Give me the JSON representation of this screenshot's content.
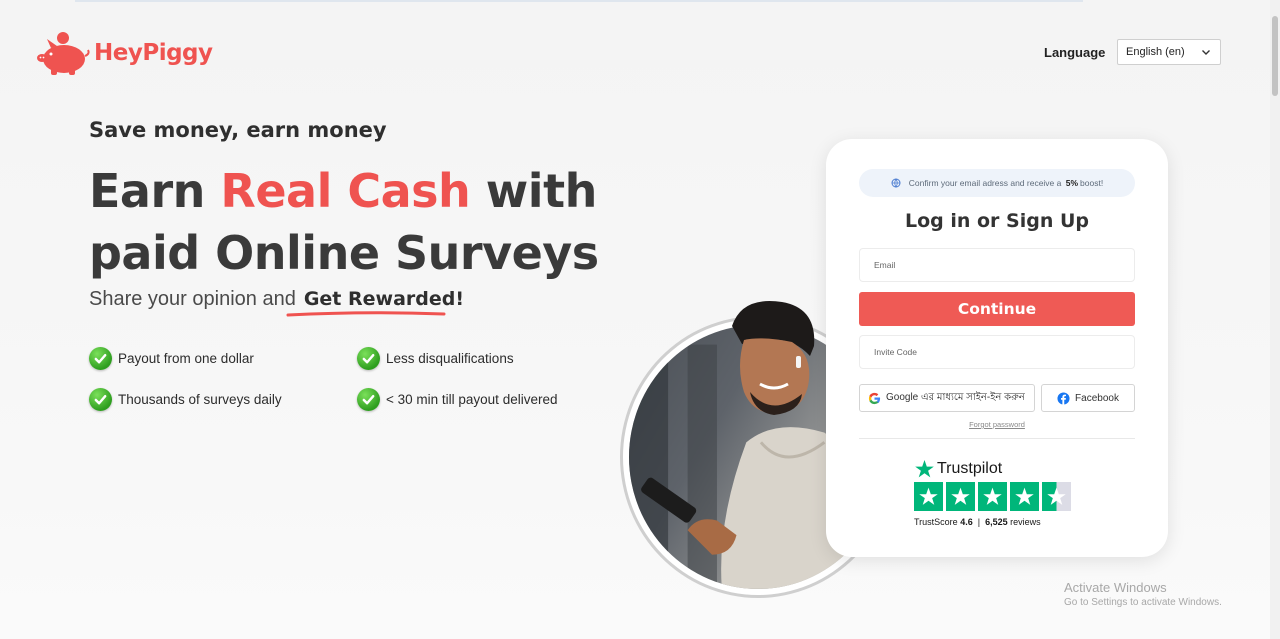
{
  "brand": {
    "name": "HeyPiggy",
    "color": "#ef5350"
  },
  "language": {
    "label": "Language",
    "selected": "English (en)"
  },
  "hero": {
    "tagline": "Save money, earn money",
    "headline_part1": "Earn ",
    "headline_accent": "Real Cash",
    "headline_part2": " with",
    "headline_line2": "paid Online Surveys",
    "sub_text": "Share your opinion and",
    "sub_strong": "Get Rewarded!"
  },
  "features": [
    {
      "label": "Payout from one dollar"
    },
    {
      "label": "Less disqualifications"
    },
    {
      "label": "Thousands of surveys daily"
    },
    {
      "label": "< 30 min till payout delivered"
    }
  ],
  "card": {
    "boost_pre": "Confirm your email adress and receive a",
    "boost_strong": "5%",
    "boost_post": "boost!",
    "title": "Log in or Sign Up",
    "email_placeholder": "Email",
    "continue_label": "Continue",
    "invite_placeholder": "Invite Code",
    "google_label": "Google এর মাধ্যমে সাইন-ইন করুন",
    "facebook_label": "Facebook",
    "forgot_label": "Forgot password"
  },
  "trustpilot": {
    "name": "Trustpilot",
    "score_label": "TrustScore",
    "score": "4.6",
    "separator": "|",
    "reviews": "6,525",
    "reviews_label": "reviews",
    "stars": 4.5
  },
  "windows": {
    "line1": "Activate Windows",
    "line2": "Go to Settings to activate Windows."
  },
  "colors": {
    "accent": "#ef5350",
    "continue": "#ef5a55",
    "trustpilot": "#00b67a",
    "check": "#2e9e1f"
  },
  "icons": [
    "piggy-bank-icon",
    "chevron-down-icon",
    "check-icon",
    "globe-icon",
    "google-icon",
    "facebook-icon",
    "trustpilot-star-icon"
  ]
}
